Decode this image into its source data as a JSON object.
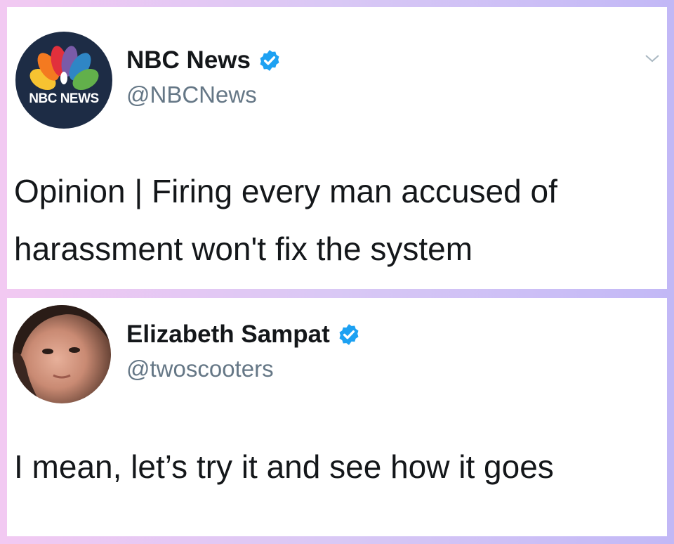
{
  "tweets": [
    {
      "name": "NBC News",
      "handle": "@NBCNews",
      "verified": true,
      "avatar_icon": "nbc-peacock-logo",
      "avatar_logo_text": "NBC NEWS",
      "text_lines": [
        "Opinion | Firing every man accused of",
        "harassment won't fix the system"
      ]
    },
    {
      "name": "Elizabeth Sampat",
      "handle": "@twoscooters",
      "verified": true,
      "avatar_icon": "profile-photo",
      "text_lines": [
        "I mean, let’s try it and see how it goes"
      ]
    }
  ],
  "colors": {
    "verified_blue": "#1da1f2",
    "text": "#14171a",
    "handle_gray": "#657786",
    "nbc_navy": "#1d2c45"
  }
}
